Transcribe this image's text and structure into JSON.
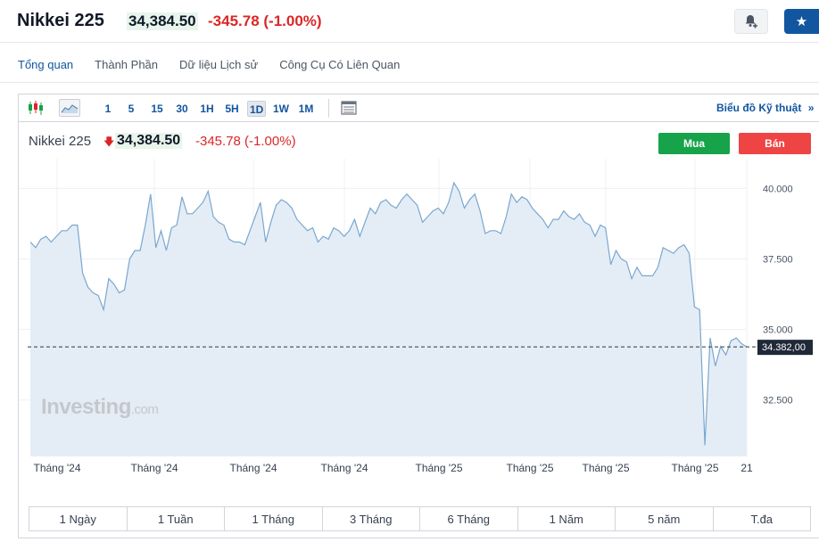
{
  "header": {
    "title": "Nikkei 225",
    "price": "34,384.50",
    "change": "-345.78 (-1.00%)"
  },
  "tabs": [
    {
      "label": "Tổng quan",
      "active": true
    },
    {
      "label": "Thành Phần",
      "active": false
    },
    {
      "label": "Dữ liệu Lịch sử",
      "active": false
    },
    {
      "label": "Công Cụ Có Liên Quan",
      "active": false
    }
  ],
  "toolbar": {
    "intervals": [
      "1",
      "5",
      "15",
      "30",
      "1H",
      "5H",
      "1D",
      "1W",
      "1M"
    ],
    "active_interval": "1D",
    "technical_link": "Biểu đồ Kỹ thuật"
  },
  "legend": {
    "name": "Nikkei 225",
    "arrow": "🡇",
    "price": "34,384.50",
    "change": "-345.78",
    "change_pct": "(-1.00%)"
  },
  "trade": {
    "buy_label": "Mua",
    "sell_label": "Bán"
  },
  "watermark": {
    "brand": "Investing",
    "suffix": ".com"
  },
  "ranges": [
    "1 Ngày",
    "1 Tuần",
    "1 Tháng",
    "3 Tháng",
    "6 Tháng",
    "1 Năm",
    "5 năm",
    "T.đa"
  ],
  "colors": {
    "accent": "#1256a0",
    "up": "#16a34a",
    "down": "#dc2626",
    "line": "#7aa7cf",
    "area": "#e4edf6"
  },
  "chart_data": {
    "type": "area",
    "ylim": [
      30500,
      40800
    ],
    "y_ticks": [
      32500,
      35000,
      37500,
      40000
    ],
    "y_tick_labels": [
      "32.500",
      "35.000",
      "37.500",
      "40.000"
    ],
    "last_value": 34382,
    "last_value_label": "34.382,00",
    "x_tick_labels": [
      "Tháng '24",
      "Tháng '24",
      "Tháng '24",
      "Tháng '24",
      "Tháng '25",
      "Tháng '25",
      "Tháng '25",
      "Tháng '25",
      "21"
    ],
    "grid": true,
    "values": [
      38100,
      37900,
      38200,
      38300,
      38100,
      38300,
      38500,
      38500,
      38700,
      38700,
      37000,
      36500,
      36300,
      36200,
      35700,
      36800,
      36600,
      36300,
      36400,
      37500,
      37800,
      37800,
      38700,
      39800,
      37900,
      38500,
      37800,
      38600,
      38700,
      39700,
      39100,
      39100,
      39300,
      39500,
      39900,
      39000,
      38800,
      38700,
      38200,
      38100,
      38100,
      38000,
      38500,
      39000,
      39500,
      38100,
      38800,
      39400,
      39600,
      39500,
      39300,
      38900,
      38700,
      38500,
      38600,
      38100,
      38300,
      38200,
      38600,
      38500,
      38300,
      38500,
      38900,
      38300,
      38800,
      39300,
      39100,
      39500,
      39600,
      39400,
      39300,
      39600,
      39800,
      39600,
      39400,
      38800,
      39000,
      39200,
      39300,
      39100,
      39500,
      40200,
      39900,
      39300,
      39600,
      39800,
      39200,
      38400,
      38500,
      38500,
      38400,
      39000,
      39800,
      39500,
      39700,
      39600,
      39300,
      39100,
      38900,
      38600,
      38900,
      38900,
      39200,
      39000,
      38900,
      39100,
      38800,
      38700,
      38300,
      38700,
      38600,
      37300,
      37800,
      37500,
      37400,
      36800,
      37200,
      36900,
      36900,
      36900,
      37200,
      37900,
      37800,
      37700,
      37900,
      38000,
      37700,
      35800,
      35700,
      30900,
      34700,
      33700,
      34400,
      34100,
      34600,
      34700,
      34500,
      34382
    ]
  }
}
